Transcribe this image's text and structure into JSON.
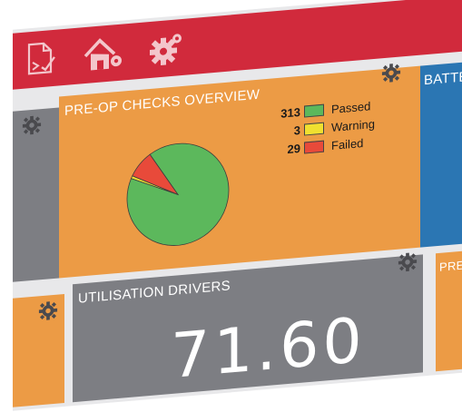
{
  "colors": {
    "topbar": "#d12a3c",
    "orange_tile": "#ec9b45",
    "grey_tile": "#7d7e83",
    "blue_tile": "#2b76b3",
    "gear_icon": "#4a4a4e",
    "passed": "#5cb85c",
    "warning": "#f0e030",
    "failed": "#e84a3a"
  },
  "toolbar": {
    "icons": [
      "checklist-icon",
      "home-settings-icon",
      "settings-icon"
    ]
  },
  "tiles": {
    "preop": {
      "title": "PRE-OP CHECKS OVERVIEW",
      "legend": [
        {
          "count": "313",
          "label": "Passed",
          "color": "#5cb85c"
        },
        {
          "count": "3",
          "label": "Warning",
          "color": "#f0e030"
        },
        {
          "count": "29",
          "label": "Failed",
          "color": "#e84a3a"
        }
      ]
    },
    "battery": {
      "title": "BATTE"
    },
    "utilisation": {
      "title": "UTILISATION  DRIVERS",
      "value": "71.60"
    },
    "partial_right": {
      "title": "PRE"
    }
  },
  "chart_data": {
    "type": "pie",
    "categories": [
      "Passed",
      "Warning",
      "Failed"
    ],
    "values": [
      313,
      3,
      29
    ],
    "colors": [
      "#5cb85c",
      "#f0e030",
      "#e84a3a"
    ],
    "legend": "right"
  }
}
